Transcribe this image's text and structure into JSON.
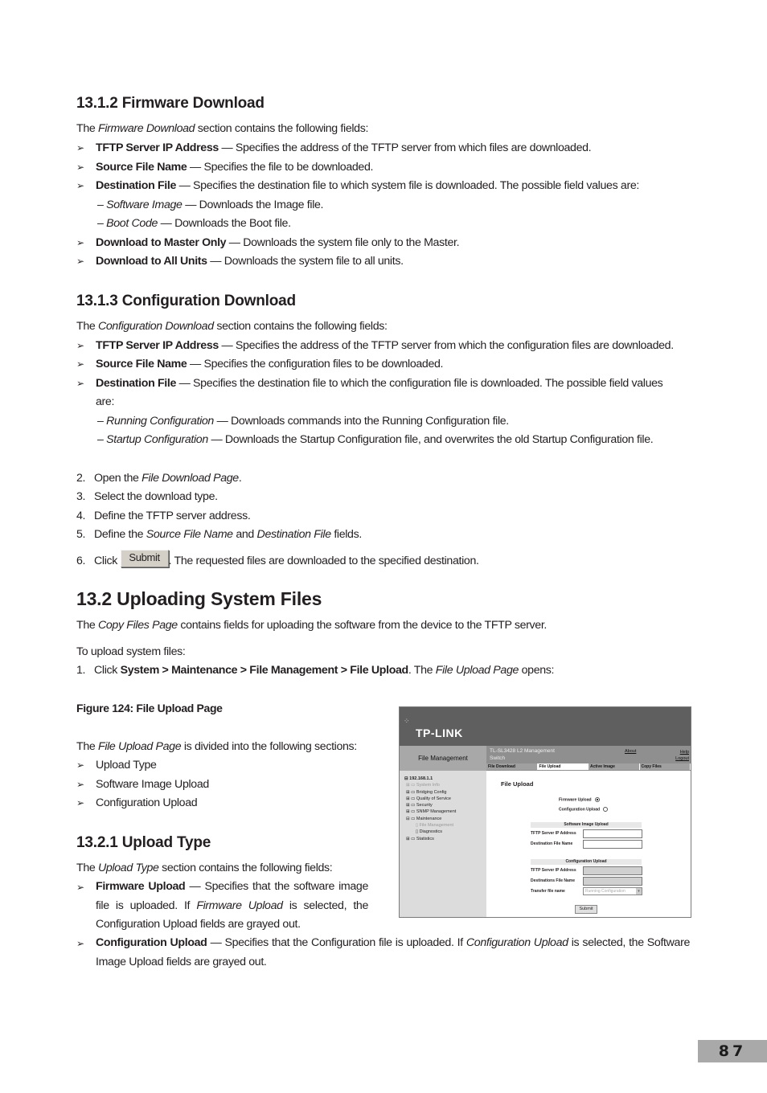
{
  "sec_1312": {
    "heading": "13.1.2   Firmware Download",
    "intro": {
      "pre": "The ",
      "em": "Firmware Download",
      "post": " section contains the following fields:"
    },
    "items": [
      {
        "term": "TFTP Server IP Address",
        "desc": " — Specifies the address of the TFTP server from which files are downloaded."
      },
      {
        "term": "Source File Name",
        "desc": " — Specifies the file to be downloaded."
      },
      {
        "term": "Destination File",
        "desc": " — Specifies the destination file to which system file is downloaded. The possible field values are:"
      }
    ],
    "values": [
      {
        "em": "Software Image",
        "desc": " — Downloads the Image file."
      },
      {
        "em": "Boot Code",
        "desc": " — Downloads the Boot file."
      }
    ],
    "items2": [
      {
        "term": "Download to Master Only",
        "desc": " — Downloads the system file only to the Master."
      },
      {
        "term": "Download to All Units",
        "desc": " — Downloads the system file to all units."
      }
    ]
  },
  "sec_1313": {
    "heading": "13.1.3   Configuration Download",
    "intro": {
      "pre": "The ",
      "em": "Configuration Download",
      "post": " section contains the following fields:"
    },
    "items": [
      {
        "term": "TFTP Server IP Address",
        "desc": " — Specifies the address of the TFTP server from which the configuration files are downloaded."
      },
      {
        "term": "Source File Name",
        "desc": " — Specifies the configuration files to be downloaded."
      },
      {
        "term": "Destination File",
        "desc": " — Specifies the destination file to which the configuration file is downloaded. The possible field values"
      }
    ],
    "continuation": "are:",
    "values": [
      {
        "em": "Running Configuration",
        "desc": " — Downloads commands into the Running Configuration file."
      },
      {
        "em": "Startup Configuration",
        "desc": " — Downloads the Startup Configuration file, and overwrites the old Startup Configuration file."
      }
    ]
  },
  "steps": [
    {
      "n": "2.",
      "pre": "Open the ",
      "em": "File Download Page",
      "post": "."
    },
    {
      "n": "3.",
      "pre": "Select the download type.",
      "em": "",
      "post": ""
    },
    {
      "n": "4.",
      "pre": "Define the TFTP server address.",
      "em": "",
      "post": ""
    },
    {
      "n": "5.",
      "pre": "Define the ",
      "em": "Source File Name",
      "mid": " and ",
      "em2": "Destination File",
      "post": " fields."
    },
    {
      "n": "6.",
      "pre": "Click ",
      "button": "Submit",
      "post": ". The requested files are downloaded to the specified destination."
    }
  ],
  "sec_132": {
    "heading": "13.2   Uploading System Files",
    "intro": {
      "pre": "The ",
      "em": "Copy Files Page",
      "post": " contains fields for uploading the software from the device to the TFTP server."
    },
    "to_upload": "To upload system files:",
    "step1": {
      "n": "1.",
      "pre": "Click ",
      "path": "System > Maintenance > File Management > File Upload",
      "mid": ". The ",
      "em": "File Upload Page",
      "post": " opens:"
    },
    "figure_caption": "Figure 124: File Upload Page",
    "divided": {
      "pre": "The ",
      "em": "File Upload Page",
      "post": " is divided into the following sections:"
    },
    "sections": [
      "Upload Type",
      "Software Image Upload",
      "Configuration Upload"
    ]
  },
  "sec_1321": {
    "heading": "13.2.1   Upload Type",
    "intro": {
      "pre": "The ",
      "em": "Upload Type",
      "post": " section contains the following fields:"
    },
    "fw": {
      "term": "Firmware Upload",
      "d1": " — Specifies that the software image file is uploaded. If ",
      "em": "Firmware Upload",
      "d2": " is selected, the Configuration Upload fields are grayed out."
    },
    "cfg": {
      "term": "Configuration Upload",
      "d1": " — Specifies that the Configuration file is uploaded. If ",
      "em": "Configuration Upload",
      "d2": " is selected, the Software Image Upload fields are grayed out."
    }
  },
  "screenshot": {
    "logo": "TP-LINK",
    "section": "File Management",
    "product_line1": "TL-SL3428 L2 Management",
    "product_line2": "Switch",
    "about": "About",
    "help": "Help",
    "logout": "Logout",
    "tabs": [
      "File Download",
      "File Upload",
      "Active Image",
      "Copy Files"
    ],
    "active_tab": "File Upload",
    "tree": {
      "root": "192.168.1.1",
      "items": [
        "System Info",
        "Bridging Config",
        "Quality of Service",
        "Security",
        "SNMP Management",
        "Maintenance"
      ],
      "children": [
        "File Management",
        "Diagnostics"
      ],
      "last": "Statistics"
    },
    "title": "File Upload",
    "radios": [
      {
        "label": "Firmware Upload",
        "checked": true
      },
      {
        "label": "Configuration Upload",
        "checked": false
      }
    ],
    "software_section": "Software Image Upload",
    "software_fields": [
      "TFTP Server IP Address",
      "Destination File Name"
    ],
    "config_section": "Configuration Upload",
    "config_fields": [
      "TFTP Server IP Address",
      "Destinations File Name",
      "Transfer file name"
    ],
    "transfer_value": "Running Configuration",
    "submit": "Submit"
  },
  "page_number": "87"
}
